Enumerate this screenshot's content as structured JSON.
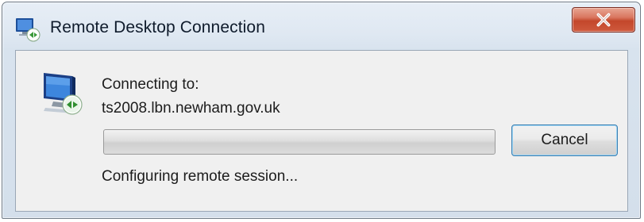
{
  "window": {
    "title": "Remote Desktop Connection",
    "close_icon": "close-icon"
  },
  "dialog": {
    "connecting_label": "Connecting to:",
    "host": "ts2008.lbn.newham.gov.uk",
    "progress_fraction": 0,
    "cancel_label": "Cancel",
    "status": "Configuring remote session..."
  },
  "icons": {
    "app": "remote-desktop-icon",
    "computer": "computer-icon"
  },
  "colors": {
    "close_button": "#c3472b",
    "focus_border": "#3c7fb1"
  }
}
